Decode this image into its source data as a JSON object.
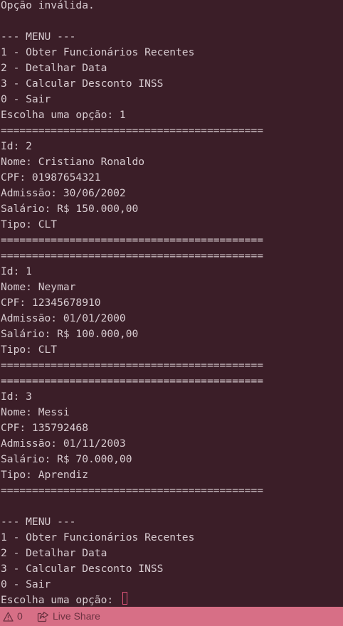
{
  "terminal": {
    "lines": [
      "Opção inválida.",
      "",
      "--- MENU ---",
      "1 - Obter Funcionários Recentes",
      "2 - Detalhar Data",
      "3 - Calcular Desconto INSS",
      "0 - Sair",
      "Escolha uma opção: 1",
      "==========================================",
      "Id: 2",
      "Nome: Cristiano Ronaldo",
      "CPF: 01987654321",
      "Admissão: 30/06/2002",
      "Salário: R$ 150.000,00",
      "Tipo: CLT",
      "==========================================",
      "==========================================",
      "Id: 1",
      "Nome: Neymar",
      "CPF: 12345678910",
      "Admissão: 01/01/2000",
      "Salário: R$ 100.000,00",
      "Tipo: CLT",
      "==========================================",
      "==========================================",
      "Id: 3",
      "Nome: Messi",
      "CPF: 135792468",
      "Admissão: 01/11/2003",
      "Salário: R$ 70.000,00",
      "Tipo: Aprendiz",
      "==========================================",
      "",
      "--- MENU ---",
      "1 - Obter Funcionários Recentes",
      "2 - Detalhar Data",
      "3 - Calcular Desconto INSS",
      "0 - Sair",
      "Escolha uma opção: "
    ]
  },
  "statusbar": {
    "warnings_count": "0",
    "warning_icon": "warning-icon",
    "live_share_label": "Live Share",
    "live_share_icon": "live-share-icon",
    "background_color": "#d76f86"
  }
}
